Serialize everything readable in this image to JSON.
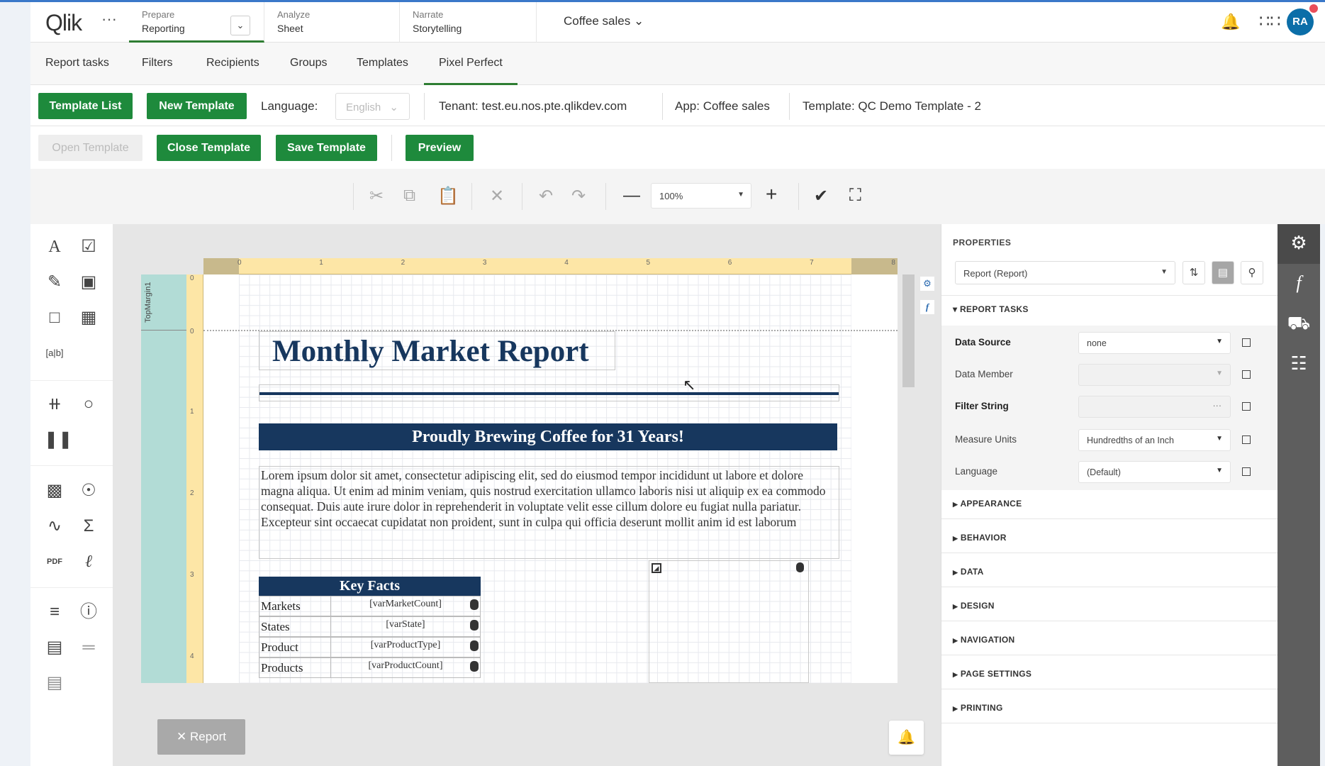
{
  "header": {
    "logo": "Qlik",
    "more": "···",
    "nav": [
      {
        "stage": "Prepare",
        "name": "Reporting"
      },
      {
        "stage": "Analyze",
        "name": "Sheet"
      },
      {
        "stage": "Narrate",
        "name": "Storytelling"
      }
    ],
    "app": "Coffee sales",
    "avatar": "RA"
  },
  "tabs": [
    "Report tasks",
    "Filters",
    "Recipients",
    "Groups",
    "Templates",
    "Pixel Perfect"
  ],
  "active_tab": "Pixel Perfect",
  "actions": {
    "template_list": "Template List",
    "new_template": "New Template",
    "language_label": "Language:",
    "language_value": "English",
    "tenant": "Tenant: test.eu.nos.pte.qlikdev.com",
    "app": "App: Coffee sales",
    "template": "Template: QC Demo Template - 2",
    "open": "Open Template",
    "close": "Close Template",
    "save": "Save Template",
    "preview": "Preview"
  },
  "toolbar": {
    "zoom": "100%"
  },
  "ruler": {
    "top": [
      "0",
      "1",
      "2",
      "3",
      "4",
      "5",
      "6",
      "7",
      "8"
    ],
    "left": [
      "0",
      "0",
      "1",
      "2",
      "3",
      "4"
    ]
  },
  "band": "TopMargin1",
  "report": {
    "title": "Monthly Market Report",
    "banner": "Proudly Brewing Coffee for 31 Years!",
    "lorem": "Lorem ipsum dolor sit amet, consectetur adipiscing elit, sed do eiusmod tempor incididunt ut labore et dolore magna aliqua. Ut enim ad minim veniam, quis nostrud exercitation ullamco laboris nisi ut aliquip ex ea commodo consequat. Duis aute irure dolor in reprehenderit in voluptate velit esse cillum dolore eu fugiat nulla pariatur. Excepteur sint occaecat cupidatat non proident, sunt in culpa qui officia deserunt mollit anim id est laborum",
    "key_facts": {
      "title": "Key Facts",
      "rows": [
        {
          "label": "Markets",
          "value": "[varMarketCount]"
        },
        {
          "label": "States",
          "value": "[varState]"
        },
        {
          "label": "Product",
          "value": "[varProductType]"
        },
        {
          "label": "Products",
          "value": "[varProductCount]"
        }
      ]
    }
  },
  "report_button": "Report",
  "properties": {
    "title": "PROPERTIES",
    "selected": "Report (Report)",
    "group": "REPORT TASKS",
    "rows": [
      {
        "label": "Data Source",
        "value": "none"
      },
      {
        "label": "Data Member",
        "value": ""
      },
      {
        "label": "Filter String",
        "value": "···"
      },
      {
        "label": "Measure Units",
        "value": "Hundredths of an Inch"
      },
      {
        "label": "Language",
        "value": "(Default)"
      }
    ],
    "sections": [
      "APPEARANCE",
      "BEHAVIOR",
      "DATA",
      "DESIGN",
      "NAVIGATION",
      "PAGE SETTINGS",
      "PRINTING"
    ]
  },
  "colors": {
    "accent": "#1e8a3c",
    "report_navy": "#17375e"
  }
}
